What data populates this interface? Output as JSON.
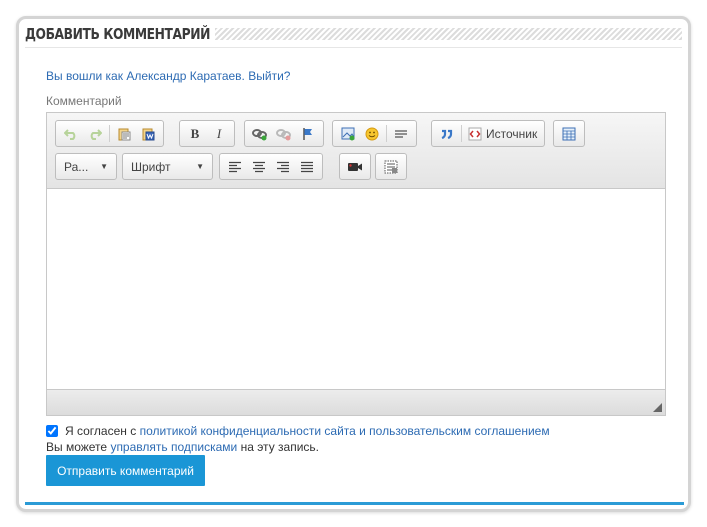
{
  "section": {
    "title": "ДОБАВИТЬ КОММЕНТАРИЙ"
  },
  "login": {
    "prefix": "Вы вошли как",
    "user": "Александр Каратаев",
    "logout": "Выйти?"
  },
  "comment": {
    "label": "Комментарий"
  },
  "toolbar": {
    "bold": "B",
    "italic": "I",
    "source_label": "Источник",
    "format_combo": "Ра...",
    "font_combo": "Шрифт"
  },
  "agreement": {
    "checked": true,
    "prefix": "Я согласен с",
    "link": "политикой конфиденциальности сайта и пользовательским соглашением"
  },
  "subscriptions": {
    "prefix": "Вы можете",
    "link": "управлять подписками",
    "suffix": "на эту запись."
  },
  "submit": {
    "label": "Отправить комментарий"
  },
  "colors": {
    "link": "#2d6bb3",
    "button": "#1a96d6",
    "accent_line": "#2b9bd6"
  }
}
